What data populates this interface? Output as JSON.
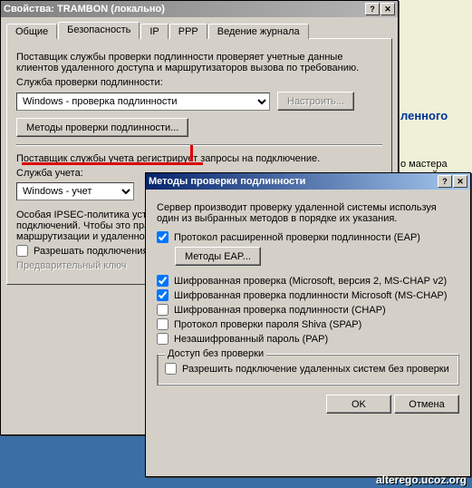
{
  "main": {
    "title": "Свойства: TRAMBON (локально)",
    "tabs": [
      "Общие",
      "Безопасность",
      "IP",
      "PPP",
      "Ведение журнала"
    ],
    "desc": "Поставщик службы проверки подлинности проверяет учетные данные клиентов удаленного доступа и маршрутизаторов вызова по требованию.",
    "auth_label": "Служба проверки подлинности:",
    "auth_value": "Windows - проверка подлинности",
    "configure": "Настроить...",
    "methods_btn": "Методы проверки подлинности...",
    "provider_desc": "Поставщик службы учета регистрирует запросы на подключение.",
    "acct_label": "Служба учета:",
    "acct_value": "Windows - учет",
    "ipsec_desc": "Особая IPSEC-политика устанавливает общий ключ для всех L2TP-подключений. Чтобы это правило вступило в силу, следует запустить службу маршрутизации и удаленного доступа.",
    "allow_custom": "Разрешать подключения",
    "preshared": "Предварительный ключ"
  },
  "dlg": {
    "title": "Методы проверки подлинности",
    "desc": "Сервер производит проверку удаленной системы используя один из выбранных методов в порядке их указания.",
    "eap": "Протокол расширенной проверки подлинности (EAP)",
    "eap_methods": "Методы EAP...",
    "mschap2": "Шифрованная проверка (Microsoft, версия 2, MS-CHAP v2)",
    "mschap": "Шифрованная проверка подлинности Microsoft (MS-CHAP)",
    "chap": "Шифрованная проверка подлинности (CHAP)",
    "spap": "Протокол проверки пароля Shiva (SPAP)",
    "pap": "Незашифрованный пароль (PAP)",
    "noauth_group": "Доступ без проверки",
    "noauth": "Разрешить подключение удаленных систем без проверки",
    "ok": "OK",
    "cancel": "Отмена"
  },
  "bg": {
    "header": "ленного",
    "wizard": "о мастера настрой"
  },
  "watermark": "alterego.ucoz.org"
}
